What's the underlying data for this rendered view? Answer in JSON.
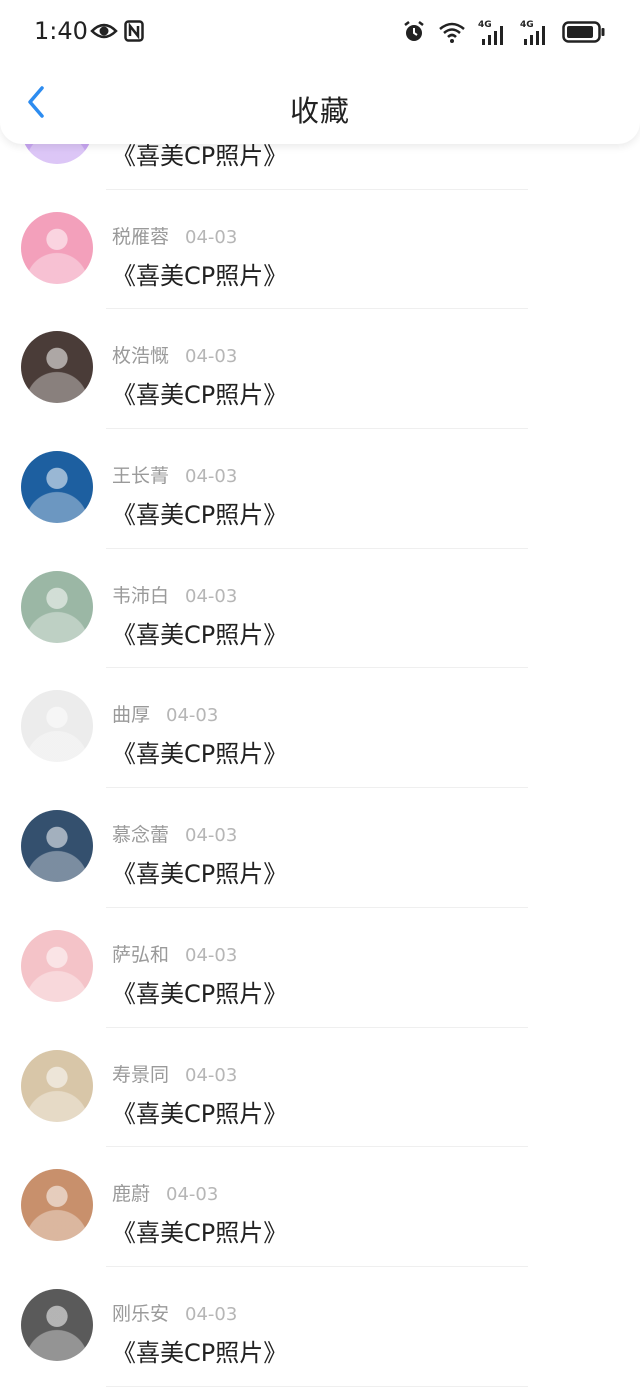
{
  "status_bar": {
    "time": "1:40",
    "left_icons": [
      "eye-icon",
      "nfc-icon"
    ],
    "right_icons": [
      "alarm-icon",
      "wifi-icon",
      "signal-4g-icon",
      "signal-4g-icon",
      "battery-icon"
    ],
    "network_label_1": "4G",
    "network_label_2": "4G"
  },
  "header": {
    "back_icon": "chevron-left-icon",
    "title": "收藏",
    "accent_color": "#2d8cf0"
  },
  "favorites": [
    {
      "name": "",
      "date": "",
      "title": "《喜美CP照片》",
      "avatar_color": "#c9a7f2"
    },
    {
      "name": "税雁蓉",
      "date": "04-03",
      "title": "《喜美CP照片》",
      "avatar_color": "#f3a0bb"
    },
    {
      "name": "枚浩慨",
      "date": "04-03",
      "title": "《喜美CP照片》",
      "avatar_color": "#4a3c38"
    },
    {
      "name": "王长菁",
      "date": "04-03",
      "title": "《喜美CP照片》",
      "avatar_color": "#1d5fa0"
    },
    {
      "name": "韦沛白",
      "date": "04-03",
      "title": "《喜美CP照片》",
      "avatar_color": "#9bb7a5"
    },
    {
      "name": "曲厚",
      "date": "04-03",
      "title": "《喜美CP照片》",
      "avatar_color": "#ececec"
    },
    {
      "name": "慕念蕾",
      "date": "04-03",
      "title": "《喜美CP照片》",
      "avatar_color": "#34506e"
    },
    {
      "name": "萨弘和",
      "date": "04-03",
      "title": "《喜美CP照片》",
      "avatar_color": "#f4c3c8"
    },
    {
      "name": "寿景同",
      "date": "04-03",
      "title": "《喜美CP照片》",
      "avatar_color": "#d8c6a8"
    },
    {
      "name": "鹿蔚",
      "date": "04-03",
      "title": "《喜美CP照片》",
      "avatar_color": "#c8906c"
    },
    {
      "name": "刚乐安",
      "date": "04-03",
      "title": "《喜美CP照片》",
      "avatar_color": "#5a5a5a"
    }
  ]
}
